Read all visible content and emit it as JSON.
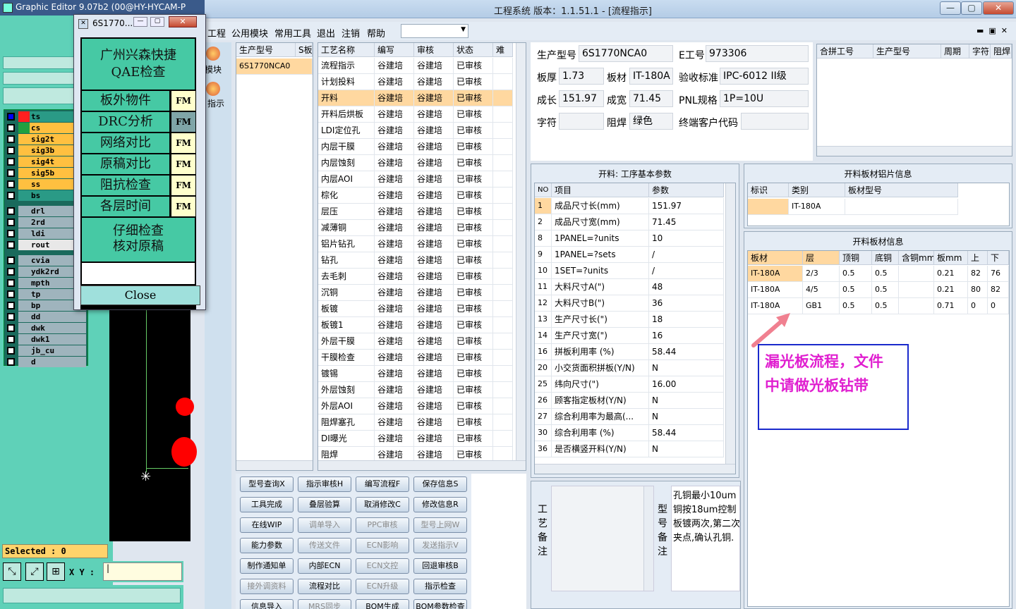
{
  "main_window": {
    "title": "工程系统   版本：1.1.51.1 - [流程指示]",
    "buttons": {
      "minimize": "—",
      "maximize": "▢",
      "close": "✕"
    }
  },
  "menubar": {
    "items": [
      "工程",
      "公用模块",
      "常用工具",
      "退出",
      "注销",
      "帮助"
    ],
    "dropdown_value": ""
  },
  "graphic_editor": {
    "title": "Graphic Editor 9.07b2 (00@HY-HYCAM-P",
    "layers": [
      {
        "name": "ts",
        "color": "#ff2020",
        "bg": "#2a9a86"
      },
      {
        "name": "cs",
        "color": "#20a040",
        "bg": "#ffc040"
      },
      {
        "name": "sig2t",
        "color": "",
        "bg": "#ffc040"
      },
      {
        "name": "sig3b",
        "color": "",
        "bg": "#ffc040"
      },
      {
        "name": "sig4t",
        "color": "",
        "bg": "#ffc040"
      },
      {
        "name": "sig5b",
        "color": "",
        "bg": "#ffc040"
      },
      {
        "name": "ss",
        "color": "",
        "bg": "#ffc040"
      },
      {
        "name": "bs",
        "color": "",
        "bg": "#2a9a86"
      },
      {
        "name": "drl",
        "color": "",
        "bg": "#9fb4bd"
      },
      {
        "name": "2rd",
        "color": "",
        "bg": "#9fb4bd"
      },
      {
        "name": "ldi",
        "color": "",
        "bg": "#9fb4bd"
      },
      {
        "name": "rout",
        "color": "",
        "bg": "#e8e8e8"
      },
      {
        "name": "cvia",
        "color": "",
        "bg": "#9fb4bd"
      },
      {
        "name": "ydk2rd",
        "color": "",
        "bg": "#9fb4bd"
      },
      {
        "name": "mpth",
        "color": "",
        "bg": "#9fb4bd"
      },
      {
        "name": "tp",
        "color": "",
        "bg": "#9fb4bd"
      },
      {
        "name": "bp",
        "color": "",
        "bg": "#9fb4bd"
      },
      {
        "name": "dd",
        "color": "",
        "bg": "#9fb4bd"
      },
      {
        "name": "dwk",
        "color": "",
        "bg": "#9fb4bd"
      },
      {
        "name": "dwk1",
        "color": "",
        "bg": "#9fb4bd"
      },
      {
        "name": "jb_cu",
        "color": "",
        "bg": "#9fb4bd"
      },
      {
        "name": "d",
        "color": "",
        "bg": "#9fb4bd"
      }
    ],
    "selected_text": "Selected : 0",
    "xy_label": "X Y :",
    "xy_value": "|"
  },
  "popup": {
    "title": "6S1770...",
    "header": "广州兴森快捷\nQAE检查",
    "items": [
      {
        "label": "板外物件",
        "fm": "FM"
      },
      {
        "label": "DRC分析",
        "fm": "FM"
      },
      {
        "label": "网络对比",
        "fm": "FM"
      },
      {
        "label": "原稿对比",
        "fm": "FM"
      },
      {
        "label": "阻抗检查",
        "fm": "FM"
      },
      {
        "label": "各层时间",
        "fm": "FM"
      }
    ],
    "footer_note": "仔细检查\n核对原稿",
    "close_label": "Close"
  },
  "sidenav": {
    "items": [
      "模块",
      "指示"
    ]
  },
  "model_list": {
    "headers": [
      "生产型号",
      "S板"
    ],
    "rows": [
      [
        "6S1770NCA0",
        ""
      ]
    ]
  },
  "process_list": {
    "headers": [
      "工艺名称",
      "编写",
      "审核",
      "状态",
      "难"
    ],
    "rows": [
      [
        "流程指示",
        "谷建培",
        "谷建培",
        "已审核"
      ],
      [
        "计划投料",
        "谷建培",
        "谷建培",
        "已审核"
      ],
      [
        "开料",
        "谷建培",
        "谷建培",
        "已审核"
      ],
      [
        "开料后烘板",
        "谷建培",
        "谷建培",
        "已审核"
      ],
      [
        "LDI定位孔",
        "谷建培",
        "谷建培",
        "已审核"
      ],
      [
        "内层干膜",
        "谷建培",
        "谷建培",
        "已审核"
      ],
      [
        "内层蚀刻",
        "谷建培",
        "谷建培",
        "已审核"
      ],
      [
        "内层AOI",
        "谷建培",
        "谷建培",
        "已审核"
      ],
      [
        "棕化",
        "谷建培",
        "谷建培",
        "已审核"
      ],
      [
        "层压",
        "谷建培",
        "谷建培",
        "已审核"
      ],
      [
        "减薄铜",
        "谷建培",
        "谷建培",
        "已审核"
      ],
      [
        "铝片钻孔",
        "谷建培",
        "谷建培",
        "已审核"
      ],
      [
        "钻孔",
        "谷建培",
        "谷建培",
        "已审核"
      ],
      [
        "去毛刺",
        "谷建培",
        "谷建培",
        "已审核"
      ],
      [
        "沉铜",
        "谷建培",
        "谷建培",
        "已审核"
      ],
      [
        "板镀",
        "谷建培",
        "谷建培",
        "已审核"
      ],
      [
        "板镀1",
        "谷建培",
        "谷建培",
        "已审核"
      ],
      [
        "外层干膜",
        "谷建培",
        "谷建培",
        "已审核"
      ],
      [
        "干膜检查",
        "谷建培",
        "谷建培",
        "已审核"
      ],
      [
        "镀锡",
        "谷建培",
        "谷建培",
        "已审核"
      ],
      [
        "外层蚀刻",
        "谷建培",
        "谷建培",
        "已审核"
      ],
      [
        "外层AOI",
        "谷建培",
        "谷建培",
        "已审核"
      ],
      [
        "阻焊塞孔",
        "谷建培",
        "谷建培",
        "已审核"
      ],
      [
        "DI曝光",
        "谷建培",
        "谷建培",
        "已审核"
      ],
      [
        "阻焊",
        "谷建培",
        "谷建培",
        "已审核"
      ]
    ],
    "selected_index": 2
  },
  "action_buttons": [
    {
      "label": "型号查询X",
      "disabled": false
    },
    {
      "label": "指示审核H",
      "disabled": false
    },
    {
      "label": "编写流程F",
      "disabled": false
    },
    {
      "label": "保存信息S",
      "disabled": false
    },
    {
      "label": "工具完成",
      "disabled": false
    },
    {
      "label": "叠层验算",
      "disabled": false
    },
    {
      "label": "取消修改C",
      "disabled": false
    },
    {
      "label": "修改信息R",
      "disabled": false
    },
    {
      "label": "在线WIP",
      "disabled": false
    },
    {
      "label": "调单导入",
      "disabled": true
    },
    {
      "label": "PPC审核",
      "disabled": true
    },
    {
      "label": "型号上网W",
      "disabled": true
    },
    {
      "label": "能力参数",
      "disabled": false
    },
    {
      "label": "传送文件",
      "disabled": true
    },
    {
      "label": "ECN影响",
      "disabled": true
    },
    {
      "label": "发送指示V",
      "disabled": true
    },
    {
      "label": "制作通知单",
      "disabled": false
    },
    {
      "label": "内部ECN",
      "disabled": false
    },
    {
      "label": "ECN文控",
      "disabled": true
    },
    {
      "label": "回退审核B",
      "disabled": false
    },
    {
      "label": "接外调资料",
      "disabled": true
    },
    {
      "label": "流程对比",
      "disabled": false
    },
    {
      "label": "ECN升级",
      "disabled": true
    },
    {
      "label": "指示检查",
      "disabled": false
    },
    {
      "label": "信息导入",
      "disabled": false
    },
    {
      "label": "MRS同步",
      "disabled": true
    },
    {
      "label": "BOM生成",
      "disabled": false
    },
    {
      "label": "BOM参数检查",
      "disabled": false
    }
  ],
  "info": {
    "model_label": "生产型号",
    "model_value": "6S1770NCA0",
    "e_label": "E工号",
    "e_value": "973306",
    "thickness_label": "板厚",
    "thickness_value": "1.73",
    "material_label": "板材",
    "material_value": "IT-180A",
    "standard_label": "验收标准",
    "standard_value": "IPC-6012 II级",
    "length_label": "成长",
    "length_value": "151.97",
    "width_label": "成宽",
    "width_value": "71.45",
    "pnl_label": "PNL规格",
    "pnl_value": "1P=10U",
    "char_label": "字符",
    "char_value": "",
    "mask_label": "阻焊",
    "mask_value": "绿色",
    "customer_label": "终端客户代码",
    "customer_value": ""
  },
  "merge_table": {
    "headers": [
      "合拼工号",
      "生产型号",
      "周期",
      "字符",
      "阻焊"
    ]
  },
  "params": {
    "title": "开料: 工序基本参数",
    "headers": [
      "NO",
      "项目",
      "参数"
    ],
    "rows": [
      [
        "1",
        "成品尺寸长(mm)",
        "151.97"
      ],
      [
        "2",
        "成品尺寸宽(mm)",
        "71.45"
      ],
      [
        "8",
        "1PANEL=?units",
        "10"
      ],
      [
        "9",
        "1PANEL=?sets",
        "/"
      ],
      [
        "10",
        "1SET=?units",
        "/"
      ],
      [
        "11",
        "大料尺寸A(\")",
        "48"
      ],
      [
        "12",
        "大料尺寸B(\")",
        "36"
      ],
      [
        "13",
        "生产尺寸长(\")",
        "18"
      ],
      [
        "14",
        "生产尺寸宽(\")",
        "16"
      ],
      [
        "16",
        "拼板利用率 (%)",
        "58.44"
      ],
      [
        "20",
        "小交货面积拼板(Y/N)",
        "N"
      ],
      [
        "25",
        "纬向尺寸(\")",
        "16.00"
      ],
      [
        "26",
        "顾客指定板材(Y/N)",
        "N"
      ],
      [
        "27",
        "综合利用率为最高(...",
        "N"
      ],
      [
        "30",
        "综合利用率 (%)",
        "58.44"
      ],
      [
        "36",
        "是否横竖开料(Y/N)",
        "N"
      ]
    ]
  },
  "aluminum": {
    "title": "开料板材铝片信息",
    "headers": [
      "标识",
      "类别",
      "板材型号"
    ],
    "rows": [
      [
        "",
        "IT-180A",
        ""
      ]
    ]
  },
  "board_info": {
    "title": "开料板材信息",
    "headers": [
      "板材",
      "层",
      "顶铜",
      "底铜",
      "含铜mm",
      "板mm",
      "上",
      "下"
    ],
    "rows": [
      [
        "IT-180A",
        "2/3",
        "0.5",
        "0.5",
        "",
        "0.21",
        "82",
        "76"
      ],
      [
        "IT-180A",
        "4/5",
        "0.5",
        "0.5",
        "",
        "0.21",
        "80",
        "82"
      ],
      [
        "IT-180A",
        "GB1",
        "0.5",
        "0.5",
        "",
        "0.71",
        "0",
        "0"
      ]
    ]
  },
  "annotation": "漏光板流程，文件\n中请做光板钻带",
  "notes": {
    "craft_label": "工艺备注",
    "craft_value": "",
    "model_label": "型号备注",
    "model_value": "孔铜最小10um\n铜按18um控制\n板镀两次,第二次\n夹点,确认孔铜."
  }
}
